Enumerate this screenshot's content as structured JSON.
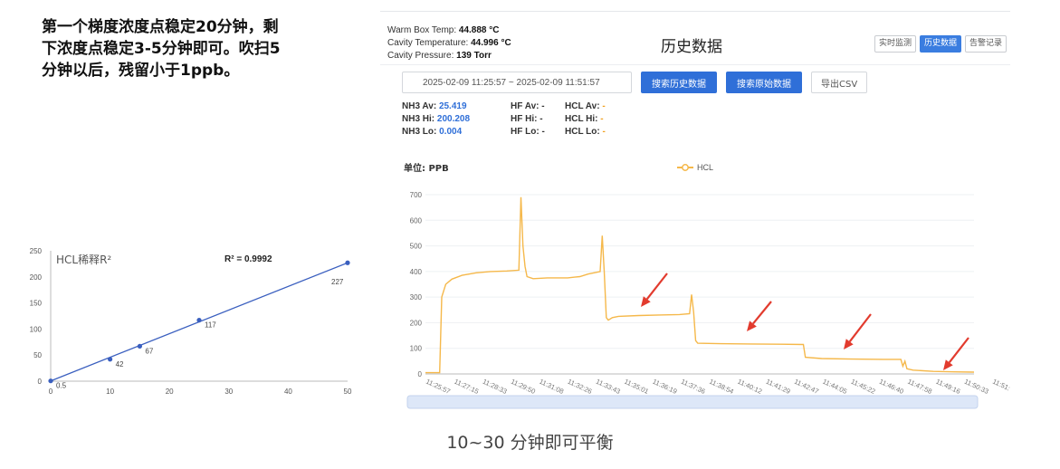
{
  "note": {
    "lines": [
      "第一个梯度浓度点稳定20分钟，剩",
      "下浓度点稳定3-5分钟即可。吹扫5",
      "分钟以后，残留小于1ppb。"
    ]
  },
  "caption": "10~30 分钟即可平衡",
  "left_chart_data": {
    "type": "scatter",
    "title": "HCL稀释R²",
    "r2_label": "R² = 0.9992",
    "xlim": [
      0,
      50
    ],
    "ylim": [
      0,
      250
    ],
    "x_ticks": [
      "0",
      "10",
      "20",
      "30",
      "40",
      "50"
    ],
    "y_ticks": [
      "0",
      "50",
      "100",
      "150",
      "200",
      "250"
    ],
    "points": [
      {
        "x": 0,
        "y": 0.5,
        "label": "0.5"
      },
      {
        "x": 10,
        "y": 42,
        "label": "42"
      },
      {
        "x": 15,
        "y": 67,
        "label": "67"
      },
      {
        "x": 25,
        "y": 117,
        "label": "117"
      },
      {
        "x": 50,
        "y": 227,
        "label": "227"
      }
    ],
    "color": "#3a5fbf"
  },
  "panel": {
    "warm_box_label": "Warm Box Temp: ",
    "warm_box_value": "44.888 °C",
    "cavity_temp_label": "Cavity Temperature: ",
    "cavity_temp_value": "44.996 °C",
    "cavity_press_label": "Cavity Pressure: ",
    "cavity_press_value": "139 Torr",
    "title": "历史数据",
    "tabs": [
      "实时监测",
      "历史数据",
      "告警记录"
    ],
    "active_tab": 1,
    "date_range": "2025-02-09 11:25:57  ~  2025-02-09 11:51:57",
    "btn_history": "搜索历史数据",
    "btn_raw": "搜索原始数据",
    "btn_csv": "导出CSV",
    "stats": {
      "nh3_av_label": "NH3 Av: ",
      "nh3_av": "25.419",
      "nh3_hi_label": "NH3 Hi: ",
      "nh3_hi": "200.208",
      "nh3_lo_label": "NH3 Lo: ",
      "nh3_lo": "0.004",
      "hf_av_label": "HF Av: ",
      "hf_hi_label": "HF Hi: ",
      "hf_lo_label": "HF Lo: ",
      "hf_val": "-",
      "hcl_av_label": "HCL Av: ",
      "hcl_hi_label": "HCL Hi: ",
      "hcl_lo_label": "HCL Lo: ",
      "hcl_val": "-"
    }
  },
  "chart_data": {
    "type": "line",
    "unit_label": "单位: PPB",
    "series": [
      {
        "name": "HCL",
        "color": "#f5b84a"
      }
    ],
    "ylim": [
      0,
      700
    ],
    "y_ticks": [
      "0",
      "100",
      "200",
      "300",
      "400",
      "500",
      "600",
      "700"
    ],
    "x_ticks": [
      "11:25:57",
      "11:27:15",
      "11:28:33",
      "11:29:50",
      "11:31:08",
      "11:32:26",
      "11:33:43",
      "11:35:01",
      "11:36:19",
      "11:37:36",
      "11:38:54",
      "11:40:12",
      "11:41:29",
      "11:42:47",
      "11:44:05",
      "11:45:22",
      "11:46:40",
      "11:47:58",
      "11:49:16",
      "11:50:33",
      "11:51:"
    ],
    "profile": [
      [
        0,
        5
      ],
      [
        0.7,
        5
      ],
      [
        0.8,
        300
      ],
      [
        1.0,
        350
      ],
      [
        1.3,
        370
      ],
      [
        1.8,
        385
      ],
      [
        2.5,
        395
      ],
      [
        3.2,
        400
      ],
      [
        4.0,
        402
      ],
      [
        4.6,
        405
      ],
      [
        4.7,
        690
      ],
      [
        4.8,
        500
      ],
      [
        4.9,
        420
      ],
      [
        5.0,
        380
      ],
      [
        5.3,
        372
      ],
      [
        6.0,
        375
      ],
      [
        7.0,
        375
      ],
      [
        7.6,
        380
      ],
      [
        8.0,
        390
      ],
      [
        8.6,
        400
      ],
      [
        8.7,
        540
      ],
      [
        8.8,
        400
      ],
      [
        8.9,
        220
      ],
      [
        9.0,
        210
      ],
      [
        9.2,
        220
      ],
      [
        9.5,
        225
      ],
      [
        10.5,
        228
      ],
      [
        11.5,
        230
      ],
      [
        12.5,
        232
      ],
      [
        13.0,
        235
      ],
      [
        13.1,
        310
      ],
      [
        13.2,
        240
      ],
      [
        13.3,
        130
      ],
      [
        13.4,
        120
      ],
      [
        14.5,
        118
      ],
      [
        16.0,
        117
      ],
      [
        17.5,
        116
      ],
      [
        18.6,
        115
      ],
      [
        18.7,
        65
      ],
      [
        19.5,
        60
      ],
      [
        21.0,
        58
      ],
      [
        22.5,
        57
      ],
      [
        23.4,
        57
      ],
      [
        23.5,
        30
      ],
      [
        23.6,
        50
      ],
      [
        23.7,
        20
      ],
      [
        24.0,
        15
      ],
      [
        25.0,
        10
      ],
      [
        26.0,
        8
      ],
      [
        27.0,
        7
      ]
    ],
    "x_profile_max": 27
  }
}
